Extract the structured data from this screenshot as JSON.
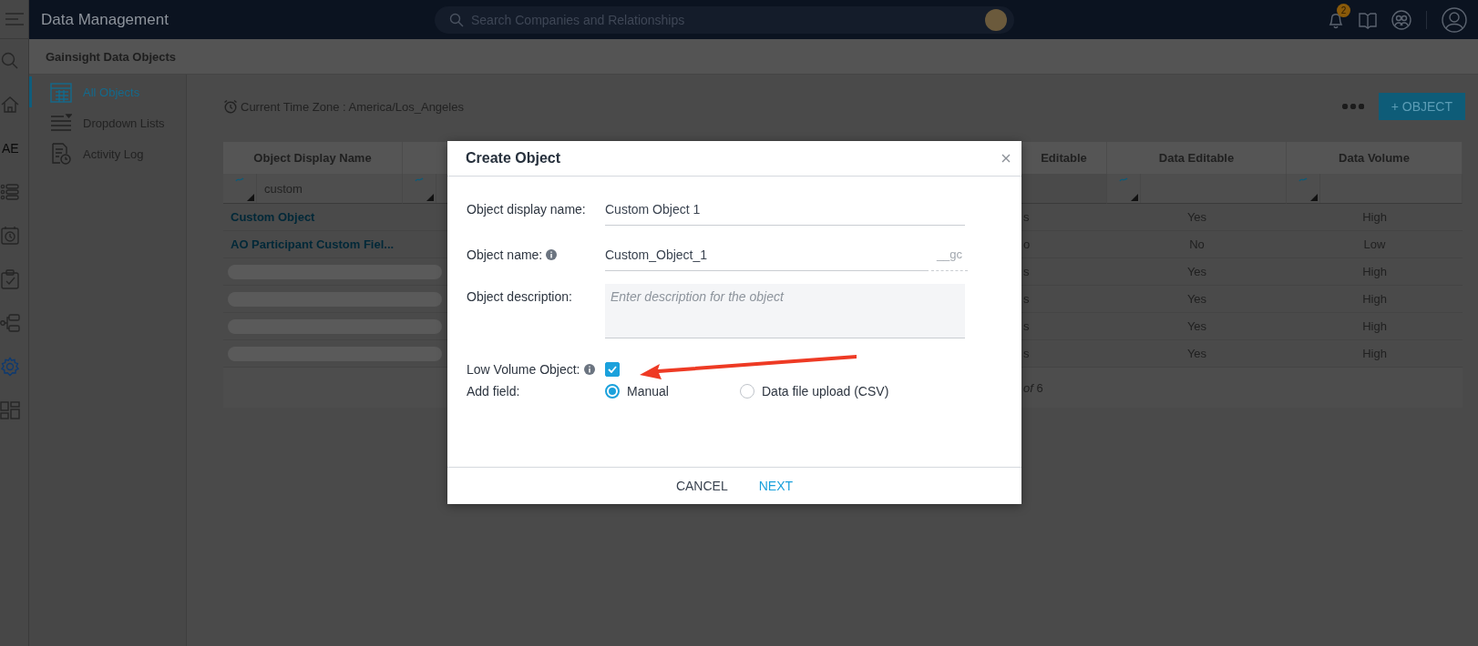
{
  "topbar": {
    "title": "Data Management",
    "search": {
      "placeholder": "Search Companies and Relationships"
    },
    "notification_count": "2"
  },
  "rail": {
    "items": [
      {
        "kind": "search",
        "selected": false
      },
      {
        "kind": "home",
        "selected": false
      },
      {
        "kind": "text",
        "label": "AE",
        "selected": false
      },
      {
        "kind": "list",
        "selected": false
      },
      {
        "kind": "schedule",
        "selected": false
      },
      {
        "kind": "tasks",
        "selected": false
      },
      {
        "kind": "hierarchy",
        "selected": false
      },
      {
        "kind": "settings",
        "selected": true
      },
      {
        "kind": "layout",
        "selected": false
      }
    ]
  },
  "section_title": "Gainsight Data Objects",
  "sidebar": {
    "items": [
      {
        "kind": "grid",
        "label": "All Objects",
        "selected": true
      },
      {
        "kind": "list",
        "label": "Dropdown Lists",
        "selected": false
      },
      {
        "kind": "log",
        "label": "Activity Log",
        "selected": false
      }
    ]
  },
  "timezone": "Current Time Zone : America/Los_Angeles",
  "add_button": "+ OBJECT",
  "table": {
    "columns": [
      {
        "label": "Object Display Name",
        "has_filter": true,
        "filter_value": "custom"
      },
      {
        "has_filter": true
      },
      {
        "label": "Editable",
        "has_filter": false
      },
      {
        "label": "Data Editable",
        "has_filter": true
      },
      {
        "label": "Data Volume",
        "has_filter": true
      }
    ],
    "rows": [
      {
        "kind": "link",
        "name": "Custom Object",
        "column_3": "s",
        "data_editable": "Yes",
        "data_volume": "High"
      },
      {
        "kind": "link",
        "name": "AO Participant Custom Fiel...",
        "column_3": "o",
        "data_editable": "No",
        "data_volume": "Low"
      },
      {
        "kind": "loading",
        "column_3": "s",
        "data_editable": "Yes",
        "data_volume": "High"
      },
      {
        "kind": "loading",
        "column_3": "s",
        "data_editable": "Yes",
        "data_volume": "High"
      },
      {
        "kind": "loading",
        "column_3": "s",
        "data_editable": "Yes",
        "data_volume": "High"
      },
      {
        "kind": "loading",
        "column_3": "s",
        "data_editable": "Yes",
        "data_volume": "High"
      }
    ],
    "pagination": "*of* 6"
  },
  "modal": {
    "title": "Create Object",
    "fields": [
      {
        "kind": "text",
        "label": "Object display name:",
        "info": false,
        "value": "Custom Object 1"
      },
      {
        "kind": "text",
        "label": "Object name:",
        "info": true,
        "value": "Custom_Object_1",
        "suffix": "__gc"
      },
      {
        "kind": "textarea",
        "label": "Object description:",
        "info": false,
        "placeholder": "Enter description for the object"
      },
      {
        "kind": "checkbox",
        "label": "Low Volume Object:",
        "info": true,
        "checked": true
      },
      {
        "kind": "radio",
        "label": "Add field:",
        "info": false,
        "options": [
          {
            "label": "Manual",
            "selected": true
          },
          {
            "label": "Data file upload (CSV)",
            "selected": false
          }
        ]
      }
    ],
    "buttons": [
      {
        "label": "CANCEL",
        "primary": false
      },
      {
        "label": "NEXT",
        "primary": true
      }
    ]
  }
}
